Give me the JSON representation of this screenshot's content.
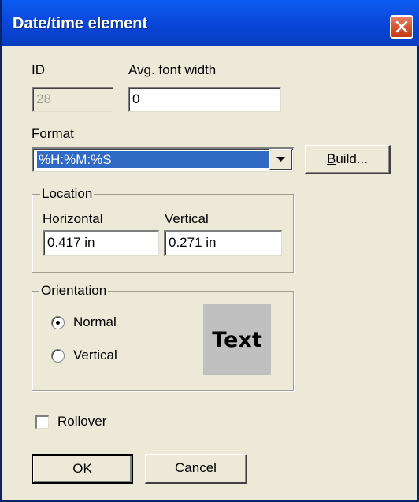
{
  "window": {
    "title": "Date/time element"
  },
  "fields": {
    "id_label": "ID",
    "id_value": "28",
    "font_width_label": "Avg. font width",
    "font_width_value": "0"
  },
  "format": {
    "label": "Format",
    "value": "%H:%M:%S",
    "build_button_prefix": "B",
    "build_button_rest": "uild..."
  },
  "location": {
    "caption": "Location",
    "horizontal_label": "Horizontal",
    "horizontal_value": "0.417 in",
    "vertical_label": "Vertical",
    "vertical_value": "0.271 in"
  },
  "orientation": {
    "caption": "Orientation",
    "normal_label": "Normal",
    "vertical_label": "Vertical",
    "selected": "Normal",
    "preview_text": "Text"
  },
  "rollover": {
    "label": "Rollover",
    "checked": false
  },
  "buttons": {
    "ok": "OK",
    "cancel": "Cancel"
  },
  "colors": {
    "titlebar": "#0845d6",
    "selection": "#316ac5",
    "dialog_bg": "#ece9d8",
    "close": "#d6512c"
  },
  "icons": {
    "close": "close-icon",
    "dropdown": "chevron-down-icon"
  }
}
